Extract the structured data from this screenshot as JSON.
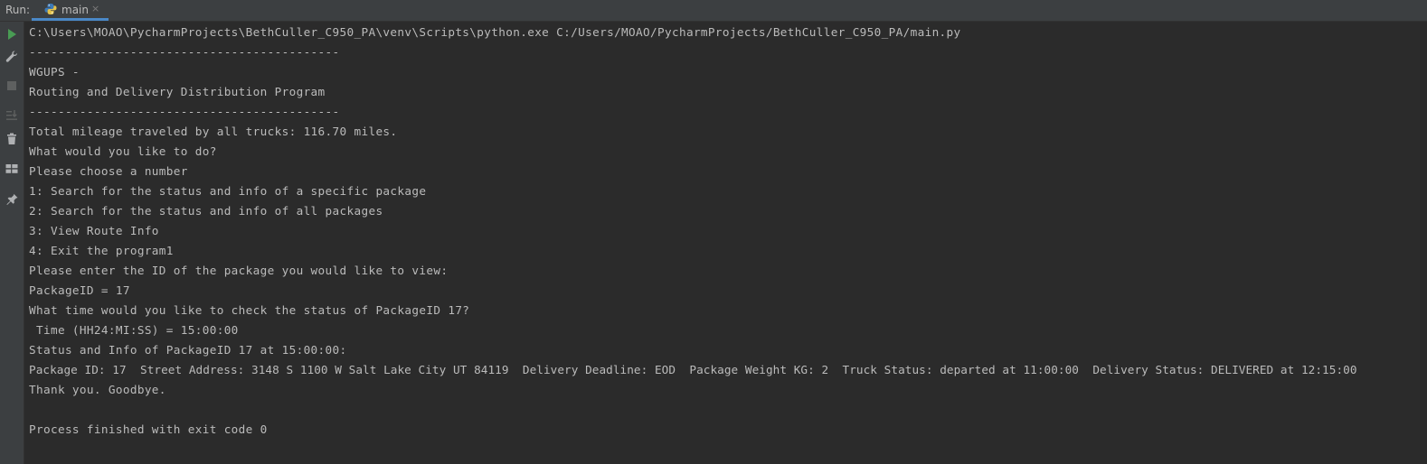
{
  "run_panel": {
    "label": "Run:",
    "tab": {
      "label": "main",
      "close_glyph": "×",
      "icon": "python-icon"
    }
  },
  "toolbar": {
    "buttons": [
      {
        "name": "rerun-button",
        "icon": "play-icon"
      },
      {
        "name": "settings-button",
        "icon": "wrench-icon"
      },
      {
        "name": "stop-button",
        "icon": "stop-icon"
      },
      {
        "name": "scroll-to-end-button",
        "icon": "scroll-down-icon"
      },
      {
        "name": "clear-all-button",
        "icon": "trash-icon"
      },
      {
        "name": "layout-button",
        "icon": "layout-icon"
      },
      {
        "name": "pin-tab-button",
        "icon": "pin-icon"
      }
    ]
  },
  "console": {
    "lines": [
      "C:\\Users\\MOAO\\PycharmProjects\\BethCuller_C950_PA\\venv\\Scripts\\python.exe C:/Users/MOAO/PycharmProjects/BethCuller_C950_PA/main.py",
      "-------------------------------------------",
      "WGUPS -",
      "Routing and Delivery Distribution Program",
      "-------------------------------------------",
      "Total mileage traveled by all trucks: 116.70 miles.",
      "What would you like to do?",
      "Please choose a number",
      "1: Search for the status and info of a specific package",
      "2: Search for the status and info of all packages",
      "3: View Route Info",
      "4: Exit the program1",
      "Please enter the ID of the package you would like to view:",
      "PackageID = 17",
      "What time would you like to check the status of PackageID 17?",
      " Time (HH24:MI:SS) = 15:00:00",
      "Status and Info of PackageID 17 at 15:00:00:",
      "Package ID: 17  Street Address: 3148 S 1100 W Salt Lake City UT 84119  Delivery Deadline: EOD  Package Weight KG: 2  Truck Status: departed at 11:00:00  Delivery Status: DELIVERED at 12:15:00",
      "Thank you. Goodbye.",
      "",
      "Process finished with exit code 0"
    ]
  },
  "colors": {
    "background": "#2b2b2b",
    "panel": "#3c3f41",
    "text": "#bbbbbb",
    "accent": "#4a88c7",
    "run_green": "#499c54"
  }
}
